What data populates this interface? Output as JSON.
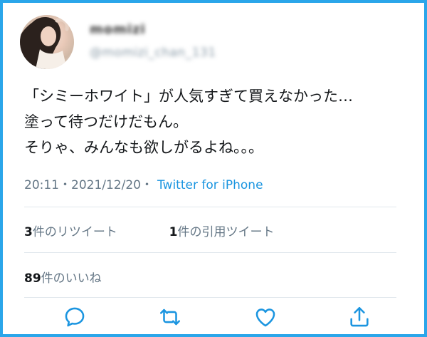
{
  "user": {
    "display_name": "momizi",
    "handle": "@momizi_chan_131"
  },
  "tweet": {
    "lines": [
      "「シミーホワイト」が人気すぎて買えなかった…",
      "塗って待つだけだもん。",
      "そりゃ、みんなも欲しがるよね。。。"
    ],
    "time": "20:11",
    "date": "2021/12/20",
    "separator": "・",
    "source": "Twitter for iPhone"
  },
  "stats": {
    "retweets_count": "3",
    "retweets_label": "件のリツイート",
    "quotes_count": "1",
    "quotes_label": "件の引用ツイート",
    "likes_count": "89",
    "likes_label": "件のいいね"
  },
  "colors": {
    "border": "#2aa6ea",
    "link": "#1b95e0",
    "muted": "#657786",
    "icon": "#1b95e0"
  },
  "actions": [
    "reply-icon",
    "retweet-icon",
    "like-icon",
    "share-icon"
  ]
}
